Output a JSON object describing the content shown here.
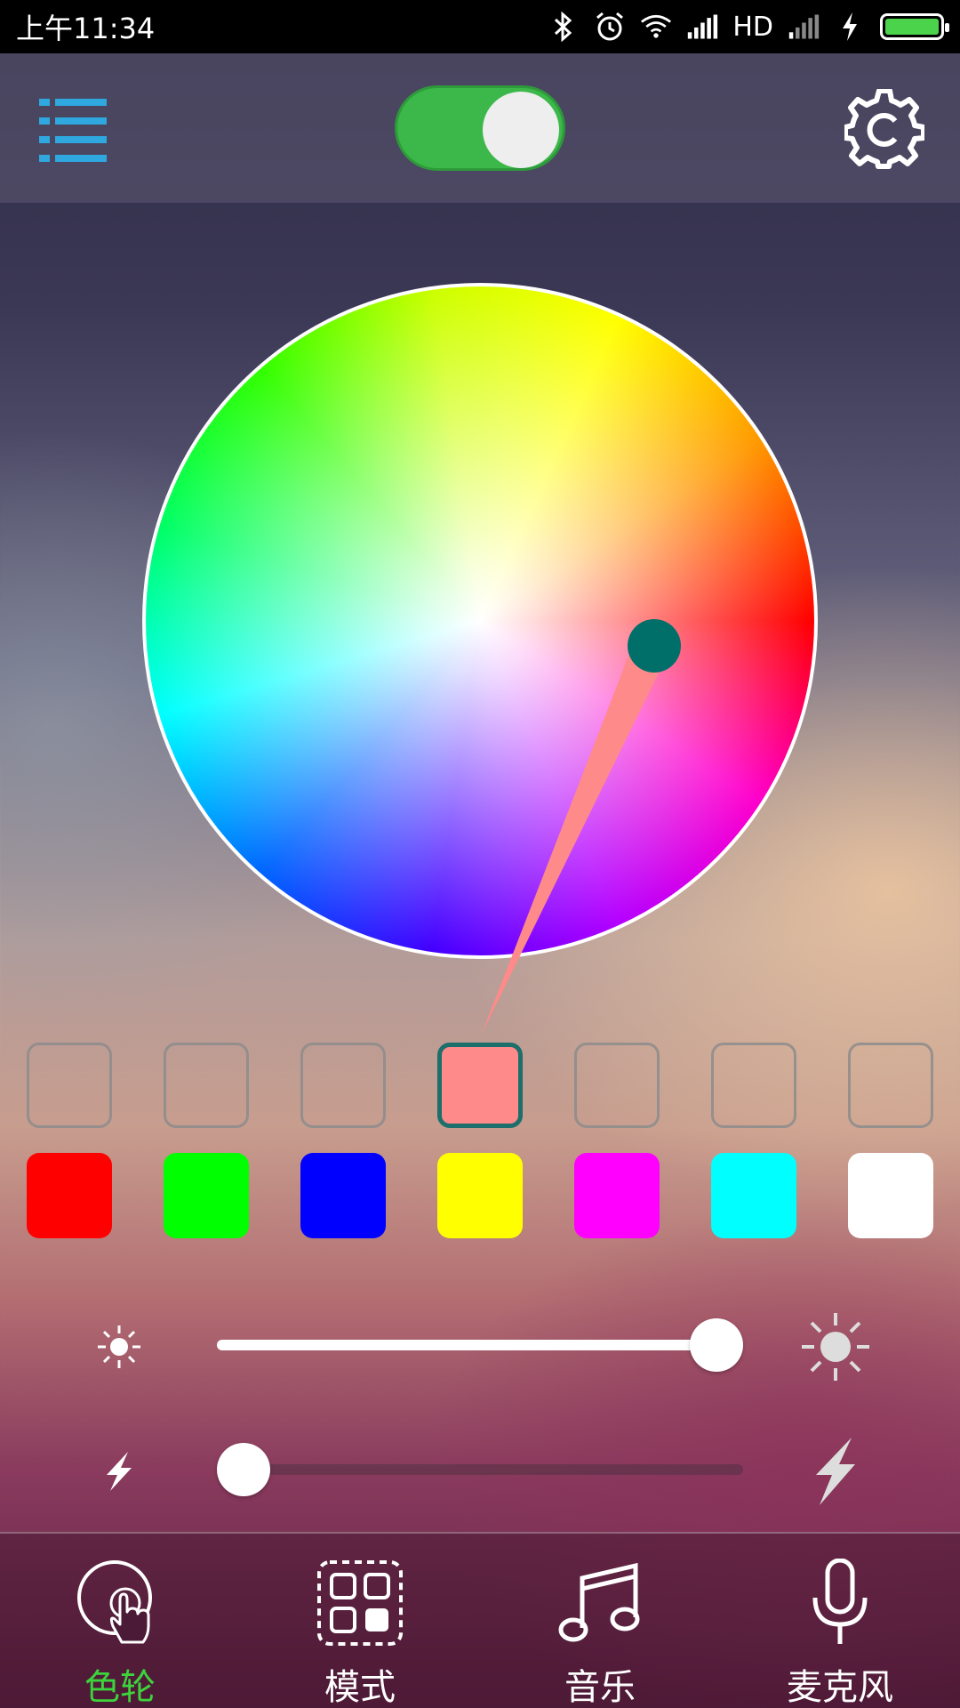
{
  "status_bar": {
    "time": "上午11:34",
    "network": "HD",
    "icons": [
      "bluetooth-icon",
      "alarm-icon",
      "wifi-icon",
      "signal-icon",
      "signal-weak-icon",
      "charging-icon",
      "battery-icon"
    ],
    "battery_level": 1.0,
    "battery_color": "#4cd34c"
  },
  "top_bar": {
    "menu_icon": "list-menu-icon",
    "menu_color": "#2fa8e0",
    "power_on": true,
    "power_color": "#3cb84a",
    "settings_icon": "gear-icon"
  },
  "color_wheel": {
    "selected_color": "#ff8a8a",
    "handle_color": "#006f6a"
  },
  "custom_slots": [
    {
      "color": null,
      "active": false
    },
    {
      "color": null,
      "active": false
    },
    {
      "color": null,
      "active": false
    },
    {
      "color": "#ff8a8a",
      "active": true
    },
    {
      "color": null,
      "active": false
    },
    {
      "color": null,
      "active": false
    },
    {
      "color": null,
      "active": false
    }
  ],
  "preset_colors": [
    "#ff0000",
    "#00ff00",
    "#0000ff",
    "#ffff00",
    "#ff00ff",
    "#00ffff",
    "#ffffff"
  ],
  "brightness": {
    "value": 1.0,
    "icon_min": "sun-small-icon",
    "icon_max": "sun-large-icon"
  },
  "speed": {
    "value": 0.0,
    "icon_min": "lightning-small-icon",
    "icon_max": "lightning-large-icon"
  },
  "bottom_nav": [
    {
      "label": "色轮",
      "icon": "color-wheel-touch-icon",
      "active": true
    },
    {
      "label": "模式",
      "icon": "mode-grid-icon",
      "active": false
    },
    {
      "label": "音乐",
      "icon": "music-note-icon",
      "active": false
    },
    {
      "label": "麦克风",
      "icon": "microphone-icon",
      "active": false
    }
  ]
}
